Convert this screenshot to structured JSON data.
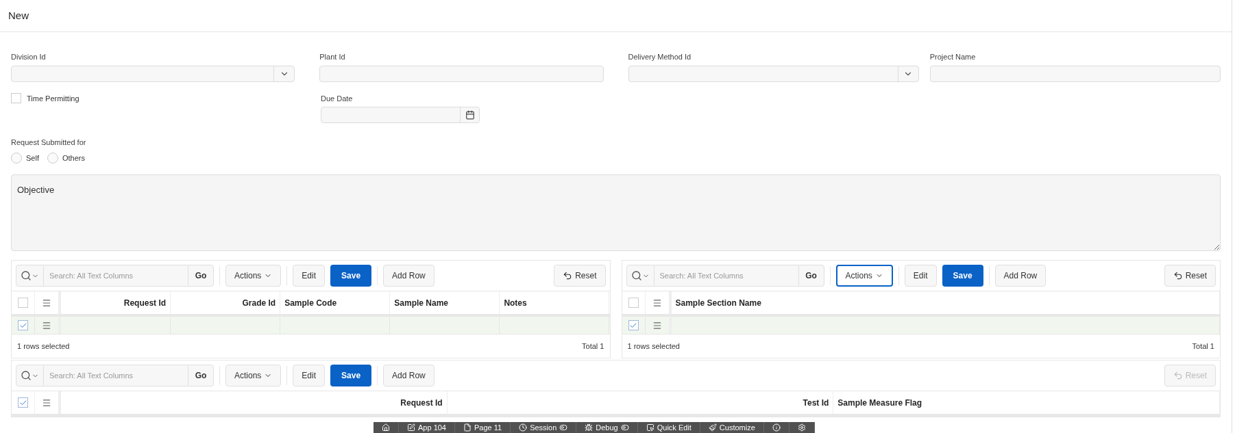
{
  "page_title": "New",
  "form": {
    "division_id": {
      "label": "Division Id"
    },
    "plant_id": {
      "label": "Plant Id"
    },
    "delivery_method_id": {
      "label": "Delivery Method Id"
    },
    "project_name": {
      "label": "Project Name"
    },
    "time_permitting": {
      "label": "Time Permitting",
      "checked": false
    },
    "due_date": {
      "label": "Due Date"
    },
    "request_submitted_for": {
      "label": "Request Submitted for",
      "options": [
        {
          "label": "Self",
          "selected": false
        },
        {
          "label": "Others",
          "selected": false
        }
      ]
    },
    "objective": {
      "placeholder": "Objective"
    }
  },
  "grids": [
    {
      "search_placeholder": "Search: All Text Columns",
      "go": "Go",
      "actions": {
        "label": "Actions",
        "focused": false
      },
      "edit": "Edit",
      "save": "Save",
      "add_row": "Add Row",
      "reset": {
        "label": "Reset",
        "disabled": false
      },
      "select_all_checked": false,
      "columns": [
        {
          "label": "Request Id",
          "kind": "number"
        },
        {
          "label": "Grade Id",
          "kind": "number"
        },
        {
          "label": "Sample Code",
          "kind": "text"
        },
        {
          "label": "Sample Name",
          "kind": "text"
        },
        {
          "label": "Notes",
          "kind": "text"
        }
      ],
      "rows": [
        {
          "selected": true
        }
      ],
      "selection_text": "1 rows selected",
      "total": "Total 1"
    },
    {
      "search_placeholder": "Search: All Text Columns",
      "go": "Go",
      "actions": {
        "label": "Actions",
        "focused": true
      },
      "edit": "Edit",
      "save": "Save",
      "add_row": "Add Row",
      "reset": {
        "label": "Reset",
        "disabled": false
      },
      "select_all_checked": false,
      "columns": [
        {
          "label": "Sample Section Name",
          "kind": "text"
        }
      ],
      "rows": [
        {
          "selected": true
        }
      ],
      "selection_text": "1 rows selected",
      "total": "Total 1"
    },
    {
      "search_placeholder": "Search: All Text Columns",
      "go": "Go",
      "actions": {
        "label": "Actions",
        "focused": false
      },
      "edit": "Edit",
      "save": "Save",
      "add_row": "Add Row",
      "reset": {
        "label": "Reset",
        "disabled": true
      },
      "select_all_checked": true,
      "columns": [
        {
          "label": "Request Id",
          "kind": "number"
        },
        {
          "label": "Test Id",
          "kind": "number"
        },
        {
          "label": "Sample Measure Flag",
          "kind": "text"
        }
      ]
    }
  ],
  "developer_toolbar": [
    {
      "kind": "home"
    },
    {
      "kind": "edit",
      "label": "App 104"
    },
    {
      "kind": "page",
      "label": "Page 11"
    },
    {
      "kind": "session",
      "label": "Session"
    },
    {
      "kind": "debug",
      "label": "Debug"
    },
    {
      "kind": "quick-edit",
      "label": "Quick Edit"
    },
    {
      "kind": "customize",
      "label": "Customize"
    },
    {
      "kind": "info"
    },
    {
      "kind": "settings"
    }
  ]
}
